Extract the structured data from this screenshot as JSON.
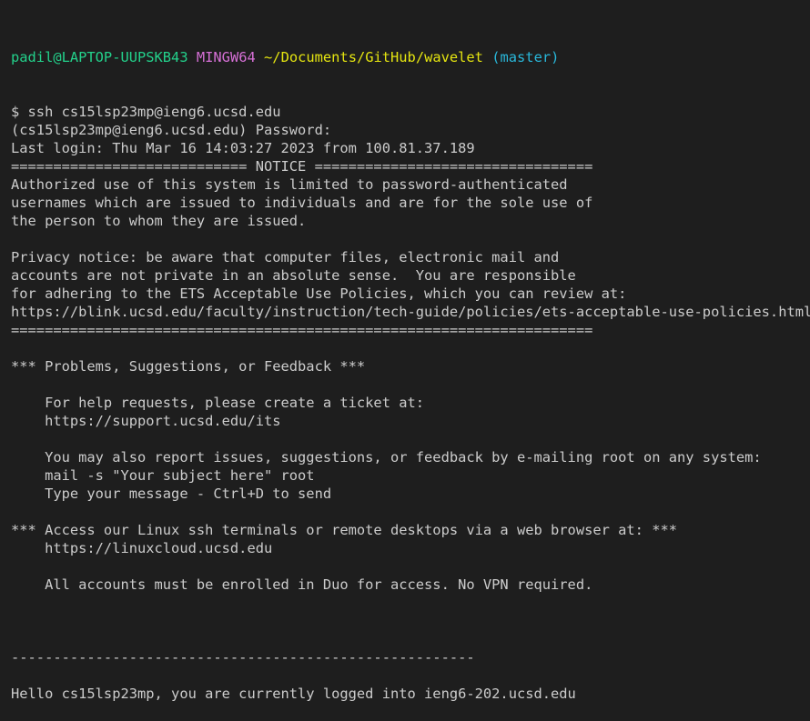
{
  "prompt": {
    "user_host": "padil@LAPTOP-UUPSKB43",
    "shell": "MINGW64",
    "path": "~/Documents/GitHub/wavelet",
    "branch": "(master)"
  },
  "lines": [
    "$ ssh cs15lsp23mp@ieng6.ucsd.edu",
    "(cs15lsp23mp@ieng6.ucsd.edu) Password:",
    "Last login: Thu Mar 16 14:03:27 2023 from 100.81.37.189",
    "============================ NOTICE =================================",
    "Authorized use of this system is limited to password-authenticated",
    "usernames which are issued to individuals and are for the sole use of",
    "the person to whom they are issued.",
    "",
    "Privacy notice: be aware that computer files, electronic mail and",
    "accounts are not private in an absolute sense.  You are responsible",
    "for adhering to the ETS Acceptable Use Policies, which you can review at:",
    "https://blink.ucsd.edu/faculty/instruction/tech-guide/policies/ets-acceptable-use-policies.html",
    "=====================================================================",
    "",
    "*** Problems, Suggestions, or Feedback ***",
    "",
    "    For help requests, please create a ticket at:",
    "    https://support.ucsd.edu/its",
    "",
    "    You may also report issues, suggestions, or feedback by e-mailing root on any system:",
    "    mail -s \"Your subject here\" root",
    "    Type your message - Ctrl+D to send",
    "",
    "*** Access our Linux ssh terminals or remote desktops via a web browser at: ***",
    "    https://linuxcloud.ucsd.edu",
    "",
    "    All accounts must be enrolled in Duo for access. No VPN required.",
    "",
    "",
    "",
    "-------------------------------------------------------",
    "",
    "Hello cs15lsp23mp, you are currently logged into ieng6-202.ucsd.edu"
  ]
}
